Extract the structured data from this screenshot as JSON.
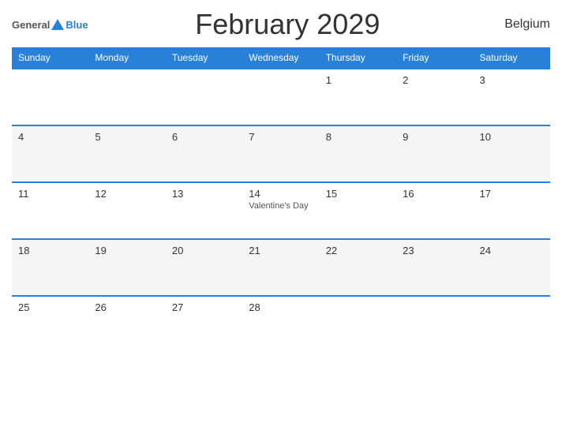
{
  "header": {
    "logo_general": "General",
    "logo_blue": "Blue",
    "title": "February 2029",
    "country": "Belgium"
  },
  "weekdays": [
    "Sunday",
    "Monday",
    "Tuesday",
    "Wednesday",
    "Thursday",
    "Friday",
    "Saturday"
  ],
  "weeks": [
    [
      {
        "day": "",
        "event": ""
      },
      {
        "day": "",
        "event": ""
      },
      {
        "day": "",
        "event": ""
      },
      {
        "day": "",
        "event": ""
      },
      {
        "day": "1",
        "event": ""
      },
      {
        "day": "2",
        "event": ""
      },
      {
        "day": "3",
        "event": ""
      }
    ],
    [
      {
        "day": "4",
        "event": ""
      },
      {
        "day": "5",
        "event": ""
      },
      {
        "day": "6",
        "event": ""
      },
      {
        "day": "7",
        "event": ""
      },
      {
        "day": "8",
        "event": ""
      },
      {
        "day": "9",
        "event": ""
      },
      {
        "day": "10",
        "event": ""
      }
    ],
    [
      {
        "day": "11",
        "event": ""
      },
      {
        "day": "12",
        "event": ""
      },
      {
        "day": "13",
        "event": ""
      },
      {
        "day": "14",
        "event": "Valentine's Day"
      },
      {
        "day": "15",
        "event": ""
      },
      {
        "day": "16",
        "event": ""
      },
      {
        "day": "17",
        "event": ""
      }
    ],
    [
      {
        "day": "18",
        "event": ""
      },
      {
        "day": "19",
        "event": ""
      },
      {
        "day": "20",
        "event": ""
      },
      {
        "day": "21",
        "event": ""
      },
      {
        "day": "22",
        "event": ""
      },
      {
        "day": "23",
        "event": ""
      },
      {
        "day": "24",
        "event": ""
      }
    ],
    [
      {
        "day": "25",
        "event": ""
      },
      {
        "day": "26",
        "event": ""
      },
      {
        "day": "27",
        "event": ""
      },
      {
        "day": "28",
        "event": ""
      },
      {
        "day": "",
        "event": ""
      },
      {
        "day": "",
        "event": ""
      },
      {
        "day": "",
        "event": ""
      }
    ]
  ]
}
